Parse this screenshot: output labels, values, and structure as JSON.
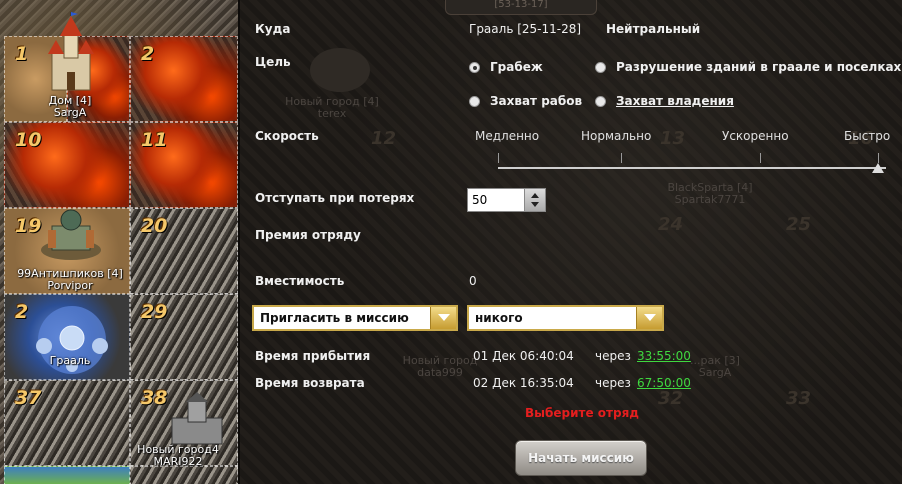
{
  "map": {
    "tiles": [
      {
        "num": "1"
      },
      {
        "num": "2"
      },
      {
        "num": "10"
      },
      {
        "num": "11"
      },
      {
        "num": "19"
      },
      {
        "num": "20"
      },
      {
        "num": "2"
      },
      {
        "num": "29"
      },
      {
        "num": "37"
      },
      {
        "num": "38"
      }
    ],
    "cities": [
      {
        "name": "Дом [4]",
        "owner": "SargA"
      },
      {
        "name": "99Антишпиков [4]",
        "owner": "Porvipor"
      },
      {
        "name": "Грааль",
        "owner": ""
      },
      {
        "name": "Новый город4",
        "owner": "MARI922"
      }
    ]
  },
  "dialog": {
    "header_coords": "[53-13-17]",
    "labels": {
      "where": "Куда",
      "goal": "Цель",
      "speed": "Скорость",
      "retreat": "Отступать при потерях",
      "bounty": "Премия отряду",
      "capacity": "Вместимость",
      "arrival": "Время прибытия",
      "return": "Время возврата"
    },
    "destination": "Грааль [25-11-28]",
    "status": "Нейтральный",
    "goals": [
      {
        "label": "Грабеж",
        "selected": true
      },
      {
        "label": "Разрушение зданий в граале и поселках",
        "selected": false
      },
      {
        "label": "Захват рабов",
        "selected": false
      },
      {
        "label": "Захват владения",
        "selected": false,
        "link": true
      }
    ],
    "speeds": [
      "Медленно",
      "Нормально",
      "Ускоренно",
      "Быстро"
    ],
    "speed_selected": "Быстро",
    "retreat_value": "50",
    "capacity_value": "0",
    "invite_select": "Пригласить в миссию",
    "invite_who": "никого",
    "arrival_date": "01 Дек 06:40:04",
    "arrival_via": "через",
    "arrival_duration": "33:55:00",
    "return_date": "02 Дек 16:35:04",
    "return_via": "через",
    "return_duration": "67:50:00",
    "error": "Выберите отряд",
    "start_button": "Начать миссию"
  },
  "background_ghosts": {
    "cities": [
      {
        "name": "Новый город [4]",
        "owner": "terex"
      },
      {
        "name": "BlackSparta [4]",
        "owner": "Spartak7771"
      },
      {
        "name": "Новый город",
        "owner": "data999"
      },
      {
        "name": "...рак [3]",
        "owner": "SargA"
      }
    ],
    "numbers": [
      "12",
      "13",
      "16",
      "24",
      "25",
      "32",
      "33"
    ]
  },
  "colors": {
    "accent_gold": "#c9a94a",
    "link_green": "#3fd83f",
    "error_red": "#e41e1e"
  }
}
